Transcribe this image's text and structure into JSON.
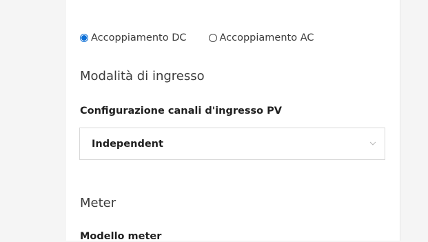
{
  "coupling": {
    "options": [
      {
        "label": "Accoppiamento DC",
        "selected": true
      },
      {
        "label": "Accoppiamento AC",
        "selected": false
      }
    ]
  },
  "input_mode": {
    "title": "Modalità di ingresso",
    "pv_channel_config_label": "Configurazione canali d'ingresso PV",
    "pv_channel_config_value": "Independent",
    "dropdown_icon": "chevron-down-icon"
  },
  "meter": {
    "title": "Meter",
    "model_label": "Modello meter"
  },
  "colors": {
    "accent": "#0a6ed6",
    "background": "#f5f5f5",
    "panel": "#ffffff",
    "border": "#d9d9d9"
  }
}
